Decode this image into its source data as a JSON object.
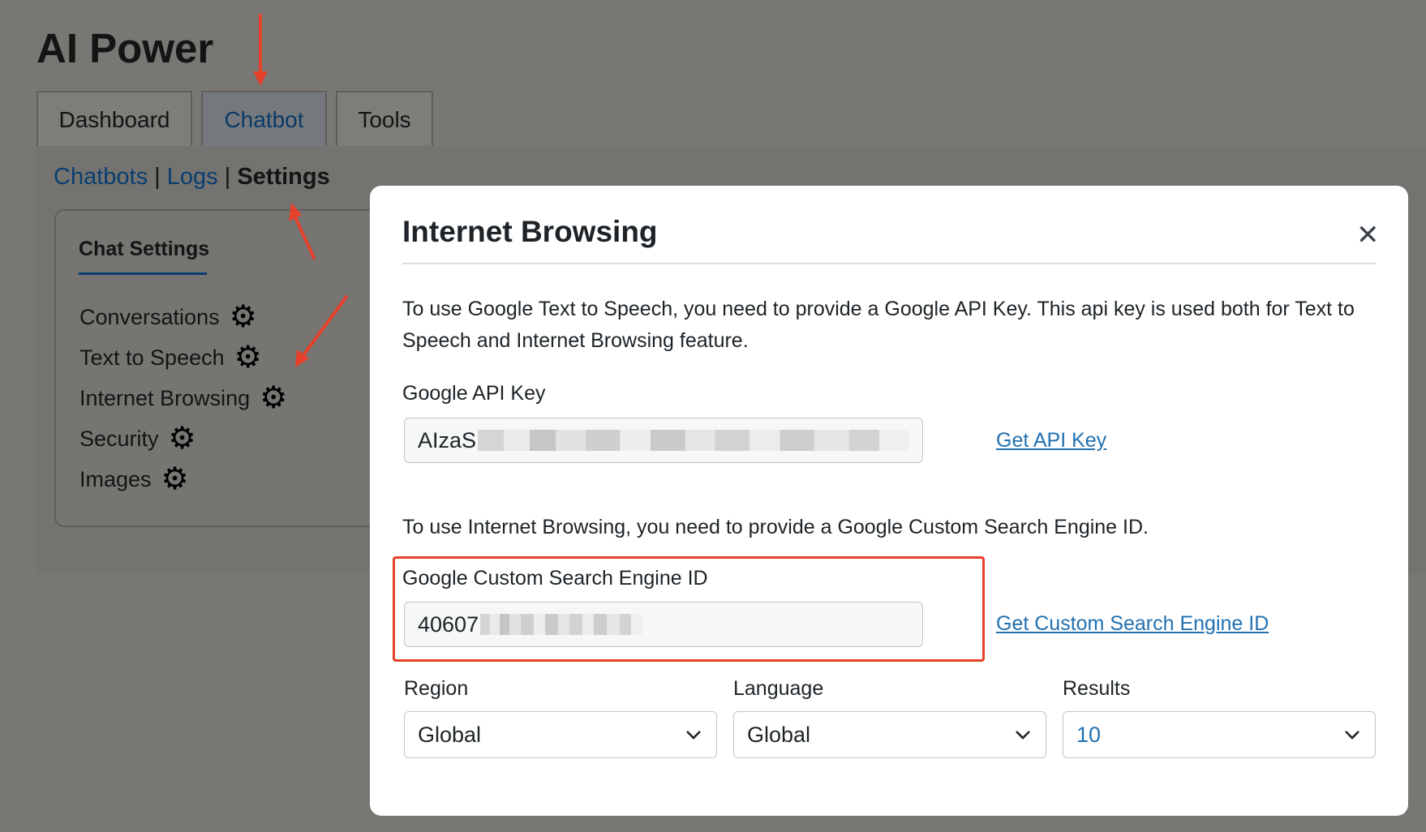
{
  "app": {
    "title": "AI Power"
  },
  "tabs": [
    {
      "label": "Dashboard"
    },
    {
      "label": "Chatbot",
      "active": true
    },
    {
      "label": "Tools"
    }
  ],
  "subnav": {
    "chatbots": "Chatbots",
    "logs": "Logs",
    "settings": "Settings",
    "separator": "|"
  },
  "chat_settings": {
    "heading": "Chat Settings",
    "items": [
      {
        "label": "Conversations",
        "icon": "gear-icon"
      },
      {
        "label": "Text to Speech",
        "icon": "gear-icon"
      },
      {
        "label": "Internet Browsing",
        "icon": "gear-icon"
      },
      {
        "label": "Security",
        "icon": "gear-icon"
      },
      {
        "label": "Images",
        "icon": "gear-icon"
      }
    ]
  },
  "modal": {
    "title": "Internet Browsing",
    "close_icon": "close-icon",
    "description_api": "To use Google Text to Speech, you need to provide a Google API Key. This api key is used both for Text to Speech and Internet Browsing feature.",
    "api_key": {
      "label": "Google API Key",
      "value_prefix": "AIzaS",
      "link": "Get API Key"
    },
    "description_cse": "To use Internet Browsing, you need to provide a Google Custom Search Engine ID.",
    "cse": {
      "label": "Google Custom Search Engine ID",
      "value_prefix": "40607",
      "link": "Get Custom Search Engine ID"
    },
    "region": {
      "label": "Region",
      "value": "Global"
    },
    "language": {
      "label": "Language",
      "value": "Global"
    },
    "results": {
      "label": "Results",
      "value": "10"
    }
  },
  "colors": {
    "overlay": "#797773",
    "link": "#2271b1",
    "annotation": "#e6412b",
    "modal_bg": "#ffffff"
  }
}
